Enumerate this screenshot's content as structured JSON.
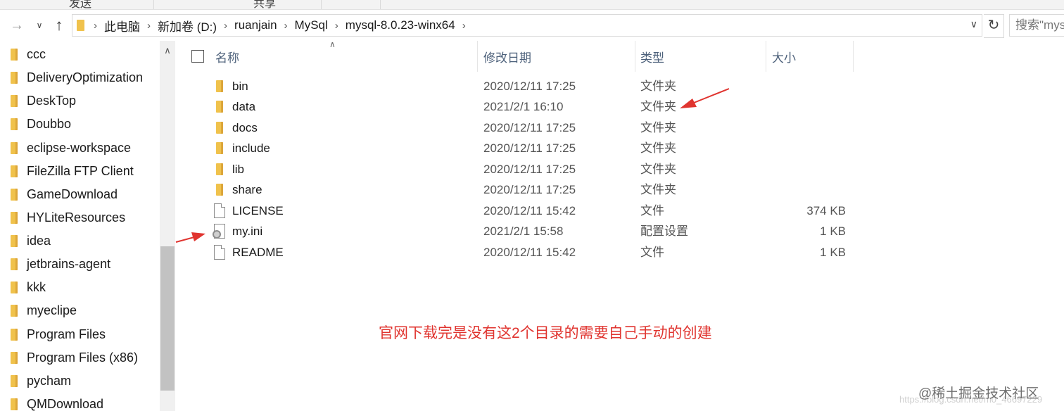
{
  "ribbon": {
    "tabs": [
      "发送",
      "共享"
    ]
  },
  "address_bar": {
    "crumbs": [
      "此电脑",
      "新加卷 (D:)",
      "ruanjain",
      "MySql",
      "mysql-8.0.23-winx64"
    ],
    "search_placeholder": "搜索\"mys"
  },
  "nav_pane": {
    "items": [
      "ccc",
      "DeliveryOptimization",
      "DeskTop",
      "Doubbo",
      "eclipse-workspace",
      "FileZilla FTP Client",
      "GameDownload",
      "HYLiteResources",
      "idea",
      "jetbrains-agent",
      "kkk",
      "myeclipe",
      "Program Files",
      "Program Files (x86)",
      "pycham",
      "QMDownload"
    ]
  },
  "columns": {
    "name": "名称",
    "date": "修改日期",
    "type": "类型",
    "size": "大小"
  },
  "files": [
    {
      "name": "bin",
      "date": "2020/12/11 17:25",
      "type": "文件夹",
      "size": "",
      "icon": "folder-icon"
    },
    {
      "name": "data",
      "date": "2021/2/1 16:10",
      "type": "文件夹",
      "size": "",
      "icon": "folder-icon"
    },
    {
      "name": "docs",
      "date": "2020/12/11 17:25",
      "type": "文件夹",
      "size": "",
      "icon": "folder-icon"
    },
    {
      "name": "include",
      "date": "2020/12/11 17:25",
      "type": "文件夹",
      "size": "",
      "icon": "folder-icon"
    },
    {
      "name": "lib",
      "date": "2020/12/11 17:25",
      "type": "文件夹",
      "size": "",
      "icon": "folder-icon"
    },
    {
      "name": "share",
      "date": "2020/12/11 17:25",
      "type": "文件夹",
      "size": "",
      "icon": "folder-icon"
    },
    {
      "name": "LICENSE",
      "date": "2020/12/11 15:42",
      "type": "文件",
      "size": "374 KB",
      "icon": "file-icon"
    },
    {
      "name": "my.ini",
      "date": "2021/2/1 15:58",
      "type": "配置设置",
      "size": "1 KB",
      "icon": "config-file-icon"
    },
    {
      "name": "README",
      "date": "2020/12/11 15:42",
      "type": "文件",
      "size": "1 KB",
      "icon": "file-icon"
    }
  ],
  "annotation": "官网下载完是没有这2个目录的需要自己手动的创建",
  "watermark": "@稀土掘金技术社区",
  "watermark_sub": "https://blog.csdn.net/m0_46697229",
  "colors": {
    "annotation": "#e0342f",
    "folder": "#f0c24c",
    "header_text": "#4c607a"
  }
}
